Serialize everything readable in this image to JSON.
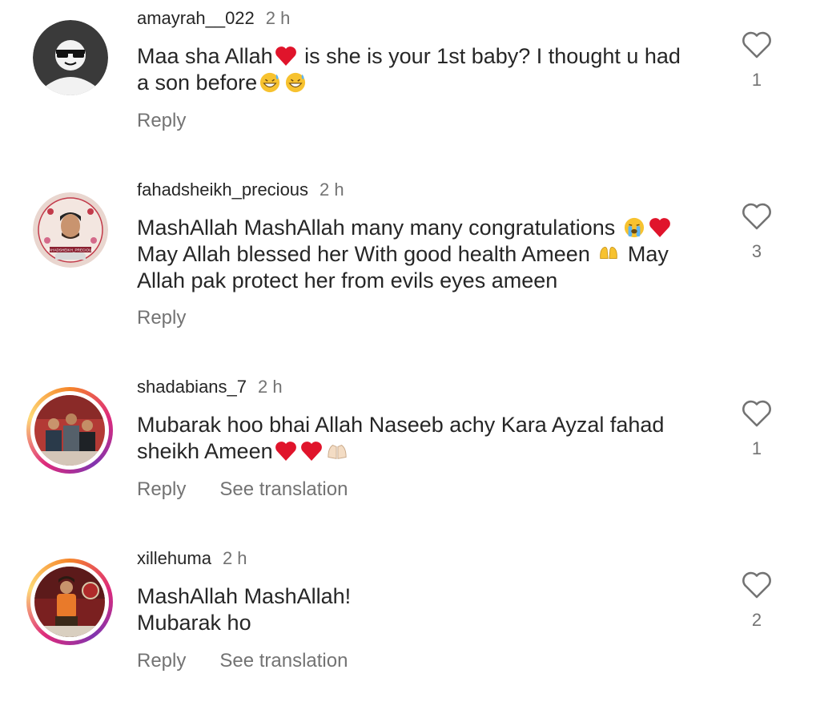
{
  "comments": [
    {
      "username": "amayrah__022",
      "time": "2 h",
      "lines": [
        "Maa sha Allah",
        "is she is your 1st baby? I thought u had",
        "a son before"
      ],
      "emojis": [
        "red-heart",
        "grinning-sweat",
        "grinning-sweat"
      ],
      "reply_label": "Reply",
      "like_count": "1"
    },
    {
      "username": "fahadsheikh_precious",
      "time": "2 h",
      "lines": [
        "MashAllah MashAllah many many congratulations",
        "May Allah blessed her With good health Ameen",
        "May",
        "Allah pak protect her from evils eyes ameen"
      ],
      "avatar_caption": "FAHADSHEIKH_PRECIOUS",
      "emojis": [
        "loudly-crying",
        "red-heart",
        "open-hands"
      ],
      "reply_label": "Reply",
      "like_count": "3"
    },
    {
      "username": "shadabians_7",
      "time": "2 h",
      "lines": [
        "Mubarak hoo bhai Allah Naseeb achy Kara Ayzal fahad",
        "sheikh Ameen"
      ],
      "emojis": [
        "red-heart",
        "red-heart",
        "palms-up-together"
      ],
      "reply_label": "Reply",
      "translate_label": "See translation",
      "like_count": "1"
    },
    {
      "username": "xillehuma",
      "time": "2 h",
      "lines": [
        "MashAllah MashAllah!",
        "Mubarak ho"
      ],
      "reply_label": "Reply",
      "translate_label": "See translation",
      "like_count": "2"
    }
  ],
  "colors": {
    "text": "#262626",
    "secondary": "#737373",
    "heart_emoji": "#e0142b",
    "story_ring_start": "#f58529",
    "story_ring_end": "#dd2a7b"
  }
}
